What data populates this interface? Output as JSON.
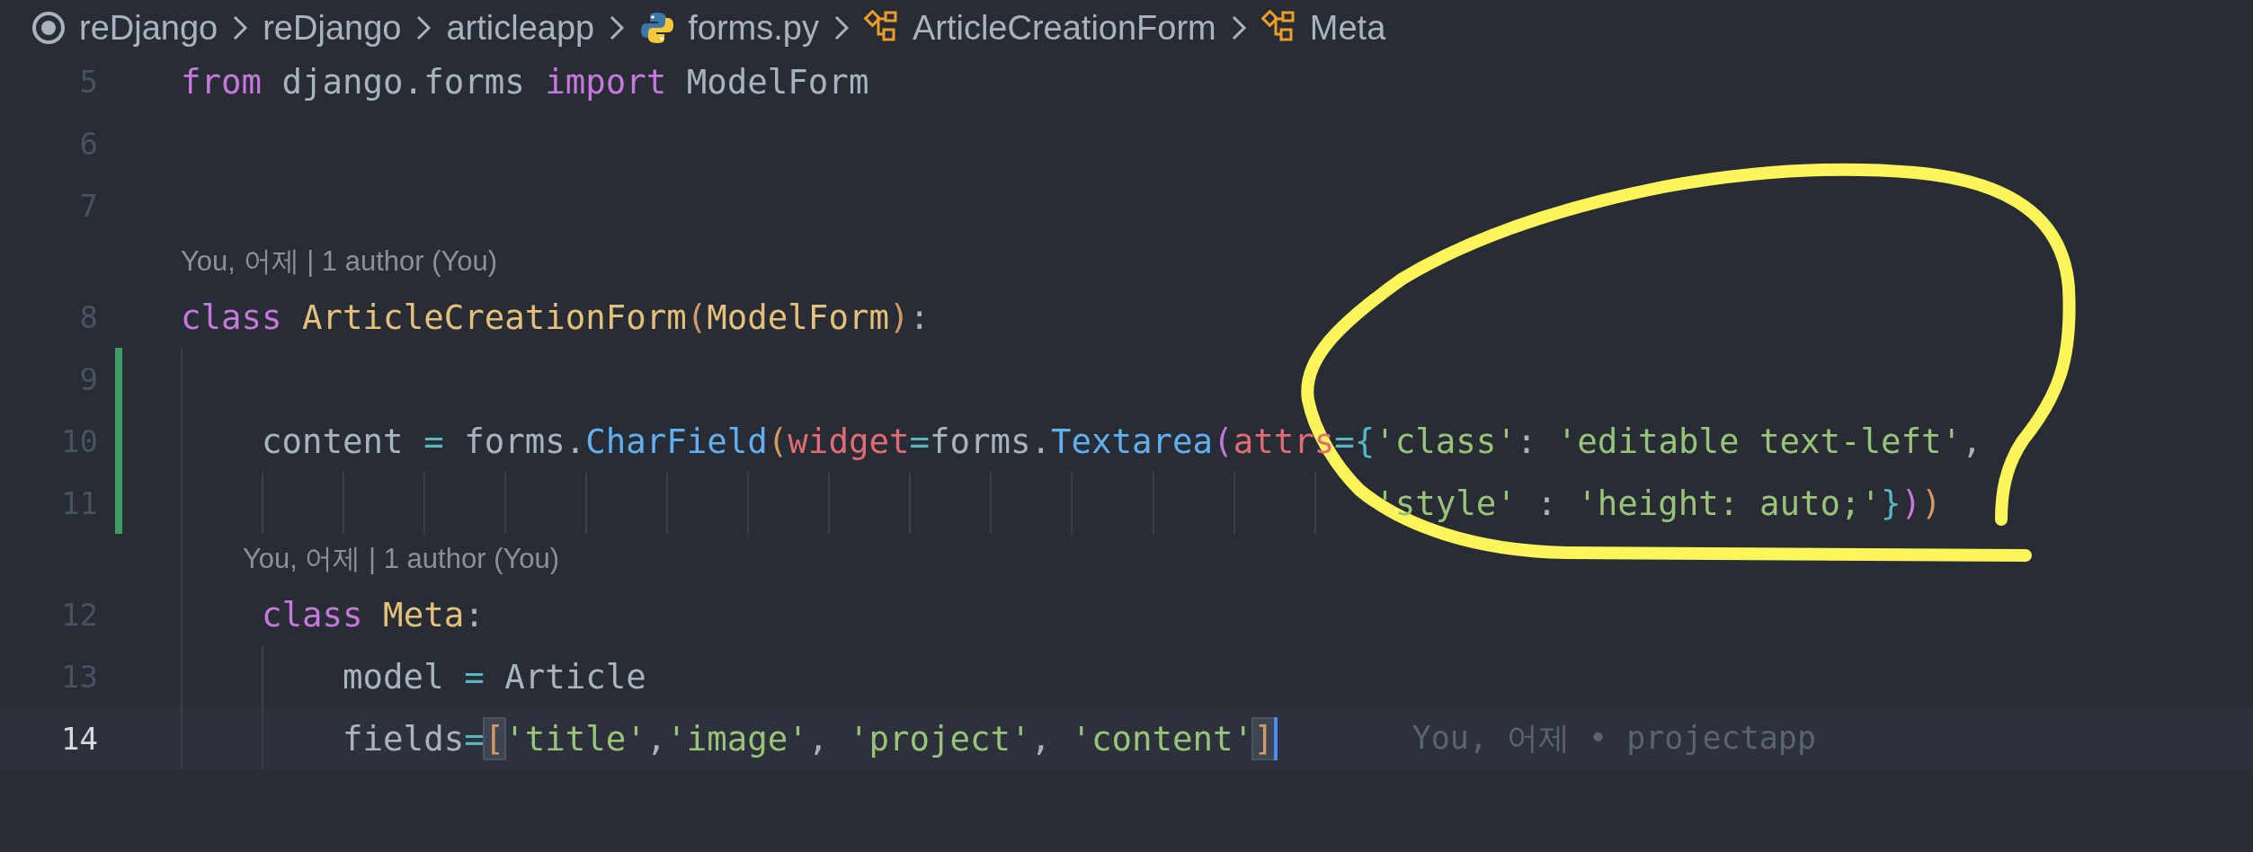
{
  "breadcrumbs": [
    {
      "label": "reDjango",
      "kind": "root"
    },
    {
      "label": "reDjango",
      "kind": "folder"
    },
    {
      "label": "articleapp",
      "kind": "folder"
    },
    {
      "label": "forms.py",
      "kind": "python"
    },
    {
      "label": "ArticleCreationForm",
      "kind": "class"
    },
    {
      "label": "Meta",
      "kind": "class"
    }
  ],
  "lines": [
    {
      "kind": "code",
      "number": "5",
      "modified": false,
      "current": false,
      "tokens": [
        {
          "text": "from",
          "kind": "keyword"
        },
        {
          "text": " django.forms ",
          "kind": "plain"
        },
        {
          "text": "import",
          "kind": "keyword"
        },
        {
          "text": " ModelForm",
          "kind": "plain"
        }
      ]
    },
    {
      "kind": "code",
      "number": "6",
      "modified": false,
      "current": false
    },
    {
      "kind": "code",
      "number": "7",
      "modified": false,
      "current": false
    },
    {
      "kind": "lens",
      "text": "You, 어제 | 1 author (You)"
    },
    {
      "kind": "code",
      "number": "8",
      "modified": false,
      "current": false,
      "tokens": [
        {
          "text": "class",
          "kind": "keyword"
        },
        {
          "text": " ArticleCreationForm",
          "kind": "class"
        },
        {
          "text": "(",
          "kind": "bracket1"
        },
        {
          "text": "ModelForm",
          "kind": "class"
        },
        {
          "text": ")",
          "kind": "bracket1"
        },
        {
          "text": ":",
          "kind": "plain"
        }
      ]
    },
    {
      "kind": "code",
      "number": "9",
      "modified": true,
      "current": false
    },
    {
      "kind": "code",
      "number": "10",
      "modified": true,
      "current": false,
      "tokens": [
        {
          "text": "    content ",
          "kind": "plain"
        },
        {
          "text": "=",
          "kind": "operator"
        },
        {
          "text": " forms.",
          "kind": "plain"
        },
        {
          "text": "CharField",
          "kind": "function"
        },
        {
          "text": "(",
          "kind": "bracket1"
        },
        {
          "text": "widget",
          "kind": "parameter"
        },
        {
          "text": "=",
          "kind": "operator"
        },
        {
          "text": "forms.",
          "kind": "plain"
        },
        {
          "text": "Textarea",
          "kind": "function"
        },
        {
          "text": "(",
          "kind": "bracket2"
        },
        {
          "text": "attrs",
          "kind": "parameter"
        },
        {
          "text": "=",
          "kind": "operator"
        },
        {
          "text": "{",
          "kind": "bracket3"
        },
        {
          "text": "'class'",
          "kind": "string"
        },
        {
          "text": ": ",
          "kind": "plain"
        },
        {
          "text": "'editable text-left'",
          "kind": "string"
        },
        {
          "text": ",",
          "kind": "plain"
        }
      ]
    },
    {
      "kind": "code",
      "number": "11",
      "modified": true,
      "current": false,
      "tokens": [
        {
          "text": "                                                           'style'",
          "kind": "string"
        },
        {
          "text": " : ",
          "kind": "plain"
        },
        {
          "text": "'height: auto;'",
          "kind": "string"
        },
        {
          "text": "}",
          "kind": "bracket3"
        },
        {
          "text": ")",
          "kind": "bracket2"
        },
        {
          "text": ")",
          "kind": "bracket1"
        }
      ]
    },
    {
      "kind": "lens",
      "text": "You, 어제 | 1 author (You)"
    },
    {
      "kind": "code",
      "number": "12",
      "modified": false,
      "current": false,
      "tokens": [
        {
          "text": "    class",
          "kind": "keyword"
        },
        {
          "text": " Meta",
          "kind": "class"
        },
        {
          "text": ":",
          "kind": "plain"
        }
      ]
    },
    {
      "kind": "code",
      "number": "13",
      "modified": false,
      "current": false,
      "tokens": [
        {
          "text": "        model ",
          "kind": "plain"
        },
        {
          "text": "=",
          "kind": "operator"
        },
        {
          "text": " Article",
          "kind": "plain"
        }
      ]
    },
    {
      "kind": "code",
      "number": "14",
      "modified": false,
      "current": true,
      "blame": "You, 어제 • projectapp",
      "tokens": [
        {
          "text": "        fields",
          "kind": "plain"
        },
        {
          "text": "=",
          "kind": "operator"
        },
        {
          "text": "[",
          "kind": "bracket-match"
        },
        {
          "text": "'title'",
          "kind": "string"
        },
        {
          "text": ",",
          "kind": "plain"
        },
        {
          "text": "'image'",
          "kind": "string"
        },
        {
          "text": ", ",
          "kind": "plain"
        },
        {
          "text": "'project'",
          "kind": "string"
        },
        {
          "text": ", ",
          "kind": "plain"
        },
        {
          "text": "'content'",
          "kind": "string"
        },
        {
          "text": "]",
          "kind": "bracket-match"
        }
      ]
    }
  ]
}
